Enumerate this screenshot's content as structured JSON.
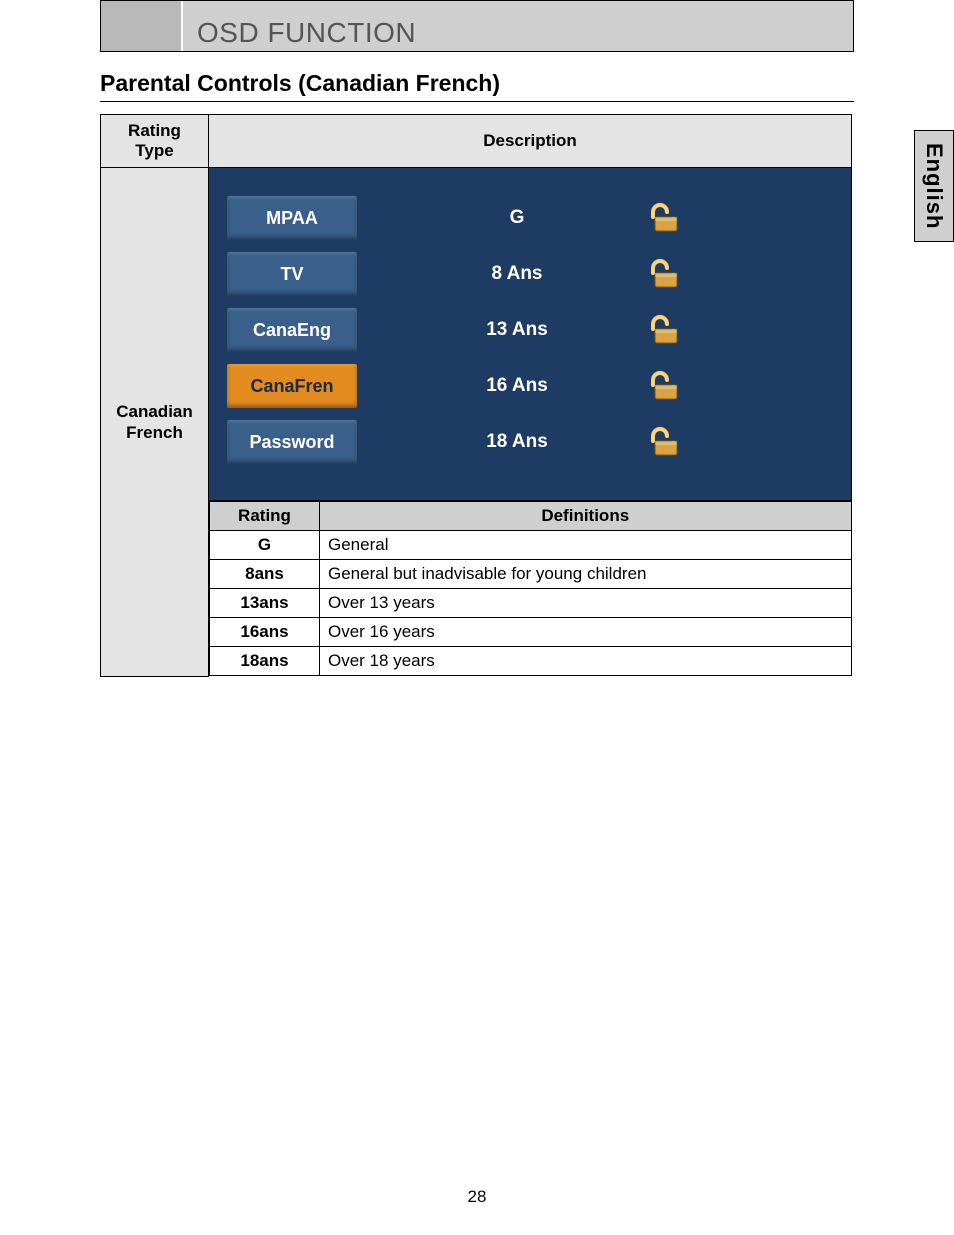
{
  "header": {
    "title": "OSD FUNCTION"
  },
  "section_title": "Parental Controls (Canadian French)",
  "side_tab": "English",
  "table_headers": {
    "rating_type": "Rating\nType",
    "description": "Description",
    "rating": "Rating",
    "definitions": "Definitions"
  },
  "rating_type_label": "Canadian\nFrench",
  "osd_menu": [
    {
      "label": "MPAA",
      "selected": false
    },
    {
      "label": "TV",
      "selected": false
    },
    {
      "label": "CanaEng",
      "selected": false
    },
    {
      "label": "CanaFren",
      "selected": true
    },
    {
      "label": "Password",
      "selected": false
    }
  ],
  "osd_ratings": [
    "G",
    "8 Ans",
    "13 Ans",
    "16 Ans",
    "18 Ans"
  ],
  "definitions": [
    {
      "rating": "G",
      "text": "General"
    },
    {
      "rating": "8ans",
      "text": "General but inadvisable for young children"
    },
    {
      "rating": "13ans",
      "text": "Over 13 years"
    },
    {
      "rating": "16ans",
      "text": "Over 16 years"
    },
    {
      "rating": "18ans",
      "text": "Over 18 years"
    }
  ],
  "page_number": "28",
  "colors": {
    "osd_bg": "#1d3b63",
    "osd_btn": "#3a5f8a",
    "osd_selected": "#e38b1e",
    "lock_body": "#d9a441",
    "lock_shackle": "#ffd27a"
  }
}
